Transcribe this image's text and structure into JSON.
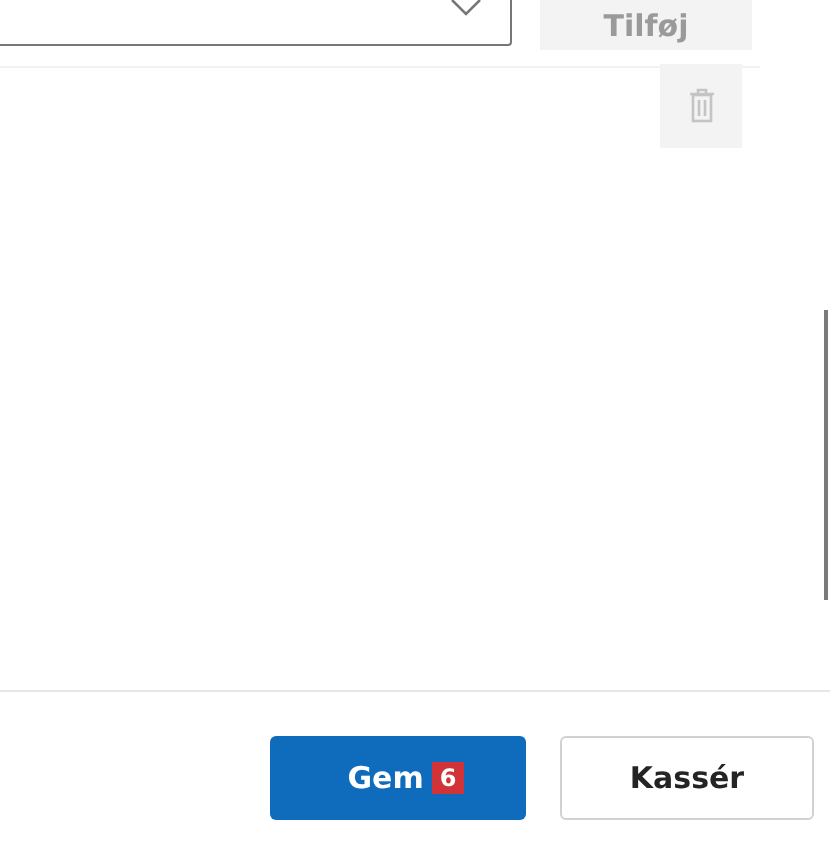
{
  "add_row": {
    "add_button": {
      "label": "Tilføj",
      "disabled": true
    }
  },
  "delete_button": {
    "disabled": true
  },
  "footer": {
    "save_button": {
      "label": "Gem",
      "badge": "6"
    },
    "discard_button": {
      "label": "Kassér"
    }
  }
}
